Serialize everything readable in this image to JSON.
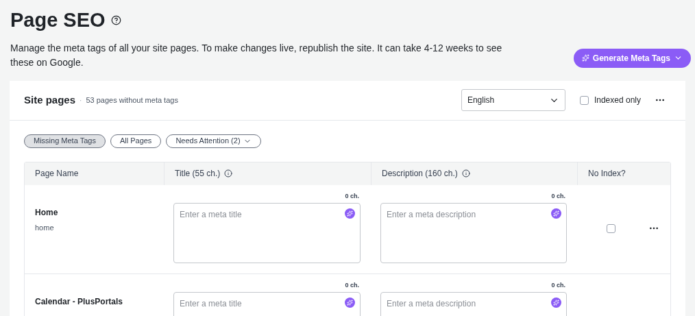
{
  "header": {
    "title": "Page SEO",
    "description": "Manage the meta tags of all your site pages. To make changes live, republish the site. It can take 4-12 weeks to see these on Google.",
    "generate_button": "Generate Meta Tags"
  },
  "card": {
    "title": "Site pages",
    "separator": "·",
    "subtitle": "53 pages without meta tags",
    "language": "English",
    "indexed_only": {
      "label": "Indexed only",
      "checked": false
    }
  },
  "filters": [
    {
      "label": "Missing Meta Tags",
      "selected": true,
      "dropdown": false
    },
    {
      "label": "All Pages",
      "selected": false,
      "dropdown": false
    },
    {
      "label": "Needs Attention (2)",
      "selected": false,
      "dropdown": true
    }
  ],
  "table": {
    "columns": [
      {
        "label": "Page Name",
        "info": false
      },
      {
        "label": "Title (55 ch.)",
        "info": true
      },
      {
        "label": "Description (160 ch.)",
        "info": true
      },
      {
        "label": "No Index?",
        "info": false
      }
    ],
    "rows": [
      {
        "name": "Home",
        "slug": "home",
        "title_count": "0 ch.",
        "title_placeholder": "Enter a meta title",
        "description_count": "0 ch.",
        "description_placeholder": "Enter a meta description",
        "no_index": false
      },
      {
        "name": "Calendar - PlusPortals",
        "title_count": "0 ch.",
        "title_placeholder": "Enter a meta title",
        "description_count": "0 ch.",
        "description_placeholder": "Enter a meta description"
      }
    ]
  }
}
